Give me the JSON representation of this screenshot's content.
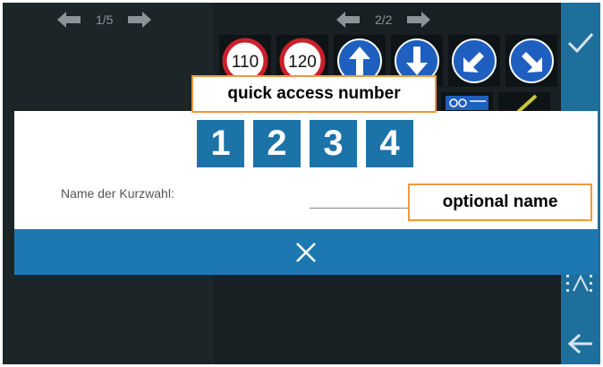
{
  "left_pager": {
    "page": "1/5"
  },
  "right_pager": {
    "page": "2/2"
  },
  "signs_row1": [
    {
      "type": "speed-limit-110",
      "text": "110"
    },
    {
      "type": "speed-limit-120",
      "text": "120"
    },
    {
      "type": "arrow-up-sign"
    },
    {
      "type": "arrow-down-sign"
    },
    {
      "type": "arrow-down-left-sign"
    },
    {
      "type": "arrow-down-right-sign"
    }
  ],
  "dialog": {
    "digits": [
      "1",
      "2",
      "3",
      "4"
    ],
    "name_label": "Name der Kurzwahl:",
    "name_value": "",
    "close_icon": "close-icon"
  },
  "callouts": {
    "quick_access": "quick access number",
    "optional_name": "optional name"
  },
  "colors": {
    "accent": "#1d78b2",
    "digit_bg": "#1c73a8",
    "callout_border": "#ef9a3b",
    "sign_red": "#c8202c",
    "sign_blue": "#1f5fbf"
  },
  "icons": {
    "confirm": "check-icon",
    "back": "arrow-left-icon",
    "prev": "arrow-left-icon",
    "next": "arrow-right-icon"
  }
}
